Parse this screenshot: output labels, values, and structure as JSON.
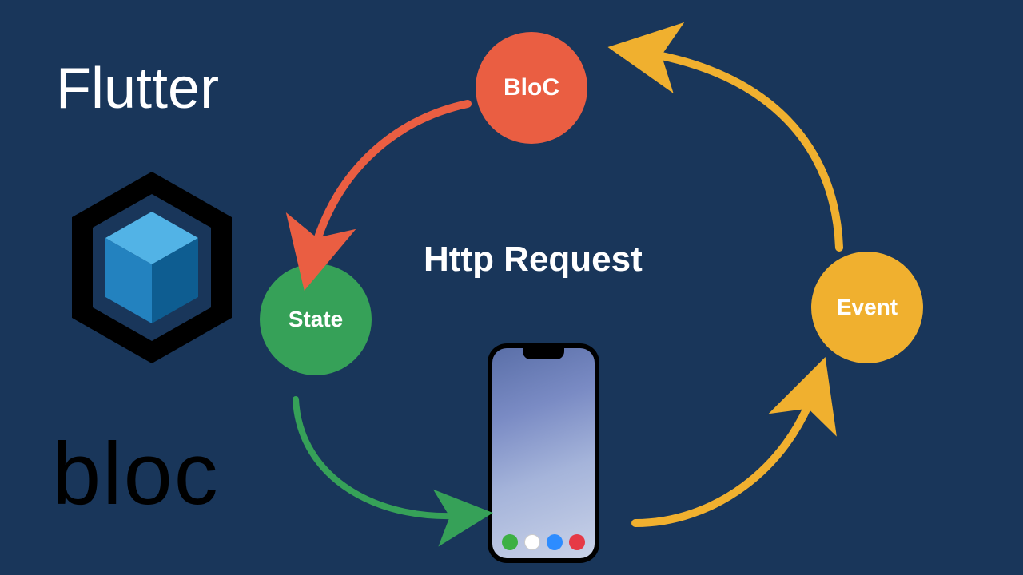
{
  "title": "Flutter",
  "logoText": "bloc",
  "centerLabel": "Http Request",
  "nodes": {
    "bloc": {
      "label": "BloC",
      "color": "#ea5e42"
    },
    "state": {
      "label": "State",
      "color": "#36a158"
    },
    "event": {
      "label": "Event",
      "color": "#f0b02f"
    }
  },
  "arrows": {
    "blocToState": {
      "color": "#ea5e42"
    },
    "eventToBloc": {
      "color": "#f0b02f"
    },
    "phoneToEvent": {
      "color": "#f0b02f"
    },
    "stateToPhone": {
      "color": "#36a158"
    }
  },
  "phoneApps": [
    {
      "color": "#3cb043"
    },
    {
      "color": "#ffffff"
    },
    {
      "color": "#2d8cff"
    },
    {
      "color": "#e63946"
    }
  ]
}
